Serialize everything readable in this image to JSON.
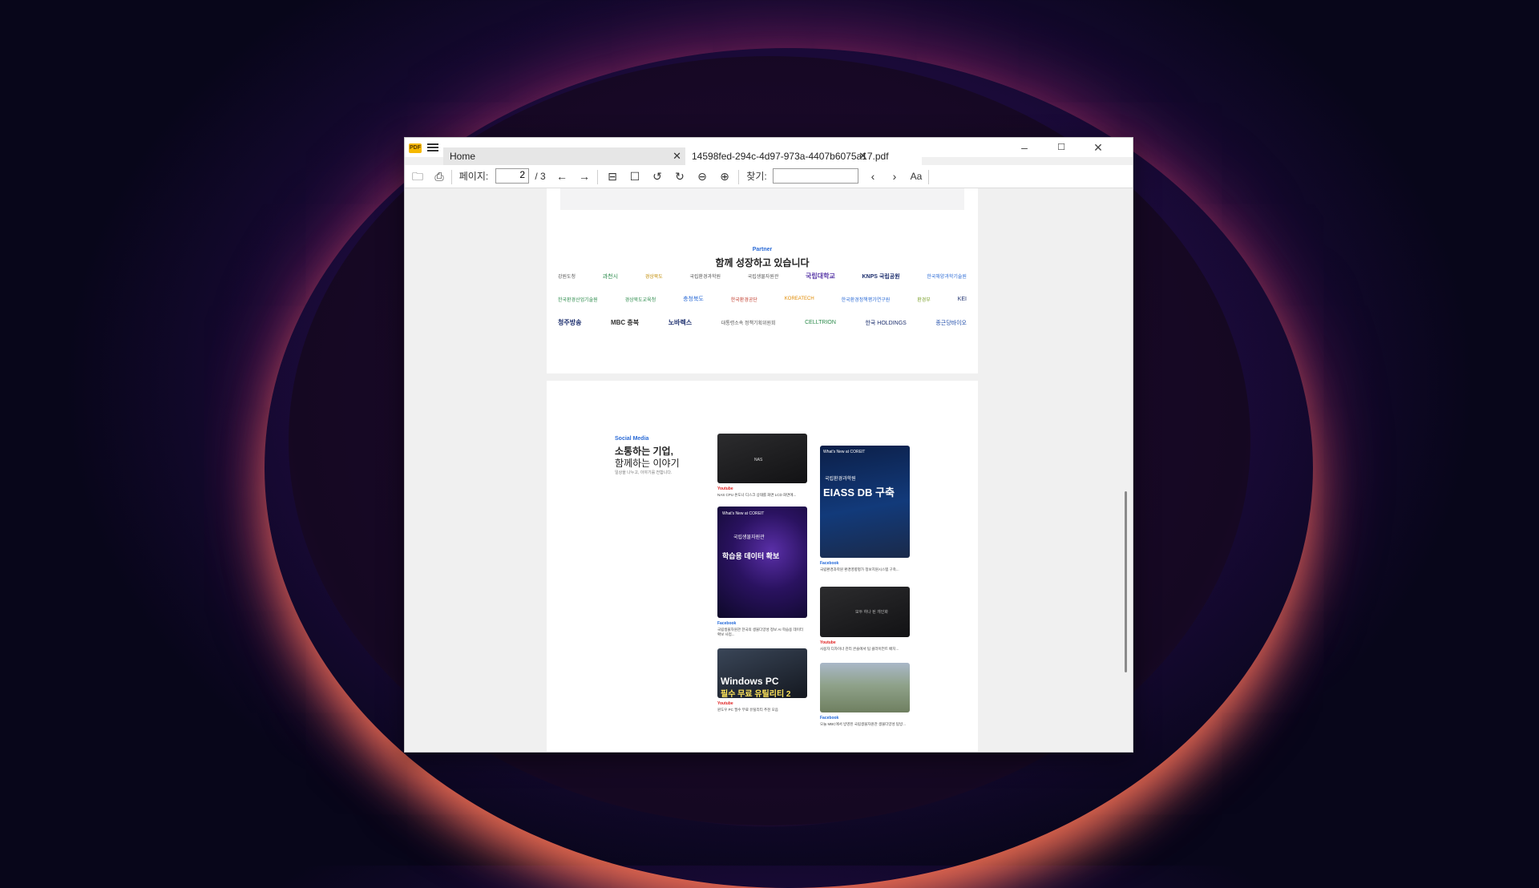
{
  "window": {
    "app_logo": "PDF",
    "tabs": [
      {
        "label": "Home"
      },
      {
        "label": "14598fed-294c-4d97-973a-4407b6075a17.pdf"
      }
    ],
    "controls": {
      "minimize": "–",
      "maximize": "☐",
      "close": "✕"
    }
  },
  "toolbar": {
    "page_label": "페이지:",
    "page_value": "2",
    "page_total": "/ 3",
    "find_label": "찾기:",
    "find_value": "",
    "font_button": "Aa"
  },
  "document": {
    "partner": {
      "label": "Partner",
      "title": "함께 성장하고 있습니다",
      "rows": [
        [
          "강원도청",
          "과천시",
          "경상북도",
          "국립환경과학원",
          "국립생물자원관",
          "국립대학교",
          "KNPS 국립공원",
          "한국해양과학기술원"
        ],
        [
          "한국환경산업기술원",
          "경상북도교육청",
          "충청북도",
          "한국환경공단",
          "KOREATECH",
          "한국환경정책평가연구원",
          "환경부",
          "KEI"
        ],
        [
          "청주방송",
          "MBC 충북",
          "노바렉스",
          "대통령소속 정책기획위원회",
          "CELLTRION",
          "한국 HOLDINGS",
          "종근당바이오"
        ]
      ]
    },
    "social": {
      "label": "Social Media",
      "title_line1": "소통하는 기업,",
      "title_line2": "함께하는 이야기",
      "subtitle": "일상을 나누고, 이야기를 전합니다.",
      "posts": [
        {
          "source": "Youtube",
          "caption": "NAS CPU 온도나 디스크 상태를 화면 LCD 화면에...",
          "thumb_text": "NAS"
        },
        {
          "source": "Facebook",
          "caption": "국립생물자원관 한국의 생물다양성 정보 AI 학습용 데이터 확보 사업...",
          "thumb_text": "학습용 데이터 확보",
          "thumb_header": "What's New at COREIT",
          "thumb_sub": "국립생물자원관"
        },
        {
          "source": "Youtube",
          "caption": "윈도우 PC 필수 무료 유틸리티 추천 모음",
          "thumb_text": "Windows PC",
          "thumb_text2": "필수 무료 유틸리티 2"
        },
        {
          "source": "Facebook",
          "caption": "국립환경과학원 환경영향평가 정보지원시스템 구축...",
          "thumb_text": "EIASS DB 구축",
          "thumb_header": "What's New at COREIT",
          "thumb_sub": "국립환경과학원"
        },
        {
          "source": "Youtube",
          "caption": "사용자 디자이너 관리 콘솔에서 팀 클라이언트 배치...",
          "thumb_text": "모두 하나 된 개인화"
        },
        {
          "source": "Facebook",
          "caption": "오늘 MBC에서 방영된 국립생물자원관 생물다양성 탐방...",
          "thumb_text": ""
        }
      ]
    }
  },
  "colors": {
    "accent": "#2b6bd6",
    "youtube": "#e02020",
    "facebook": "#1c64d8"
  }
}
